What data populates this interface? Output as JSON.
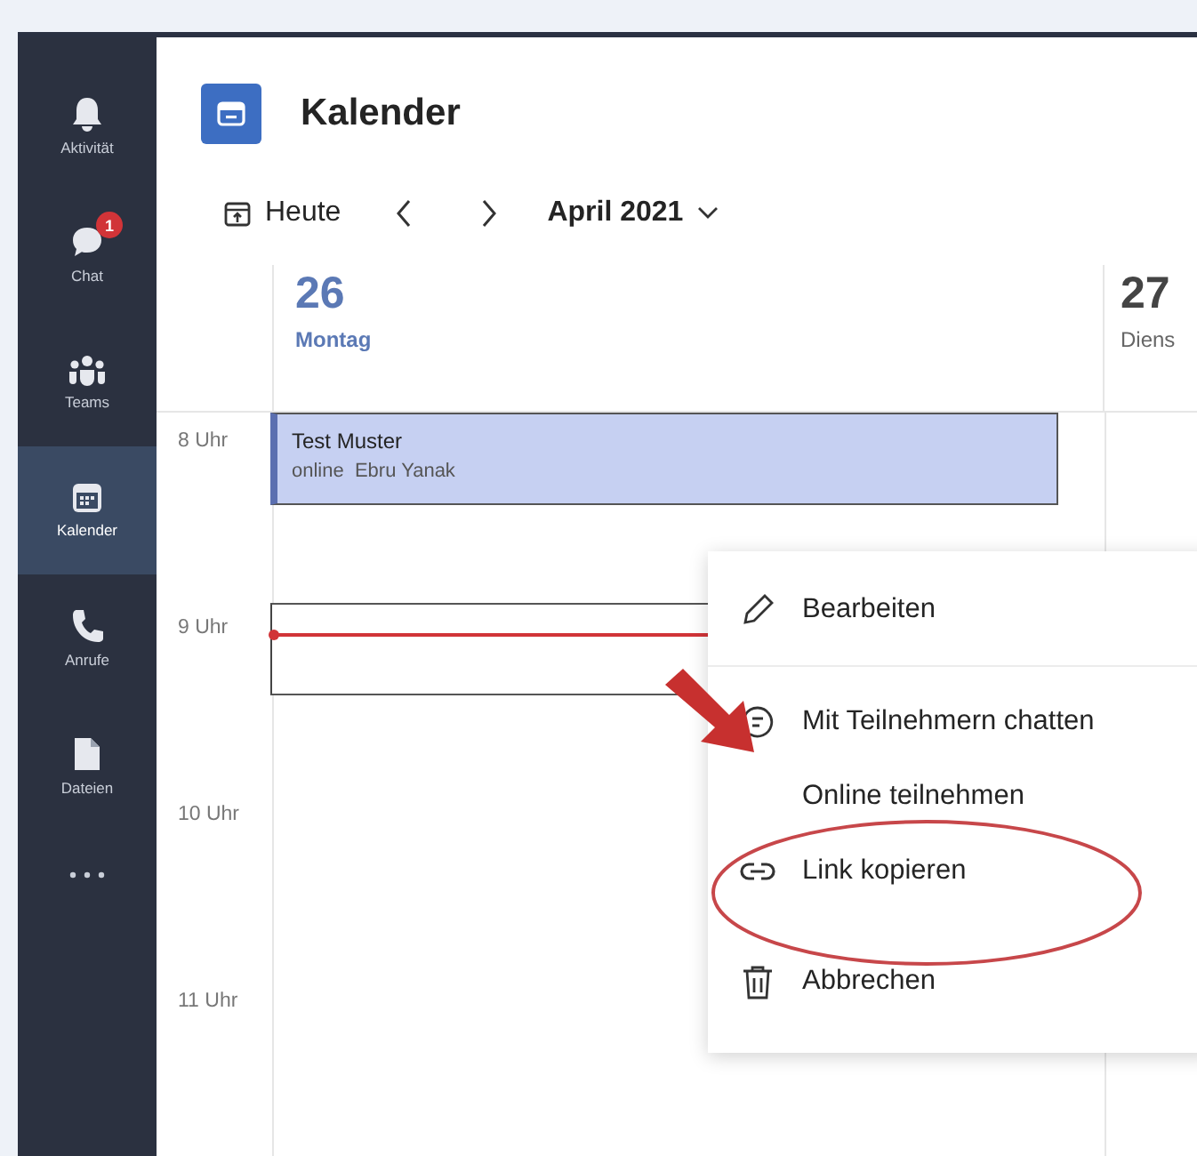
{
  "rail": {
    "items": [
      {
        "label": "Aktivität",
        "selected": false
      },
      {
        "label": "Chat",
        "badge": "1",
        "selected": false
      },
      {
        "label": "Teams",
        "selected": false
      },
      {
        "label": "Kalender",
        "selected": true
      },
      {
        "label": "Anrufe",
        "selected": false
      },
      {
        "label": "Dateien",
        "selected": false
      }
    ]
  },
  "header": {
    "title": "Kalender"
  },
  "toolbar": {
    "today": "Heute",
    "month": "April 2021"
  },
  "days": [
    {
      "number": "26",
      "name": "Montag",
      "selected": true
    },
    {
      "number": "27",
      "name": "Diens",
      "selected": false
    }
  ],
  "hours": [
    "8 Uhr",
    "9 Uhr",
    "10 Uhr",
    "11 Uhr"
  ],
  "events": [
    {
      "kind": "meeting",
      "title": "Test Muster",
      "details": "online  Ebru Yanak"
    },
    {
      "kind": "selection"
    }
  ],
  "context_menu": {
    "items": [
      {
        "label": "Bearbeiten"
      },
      {
        "label": "Mit Teilnehmern chatten"
      },
      {
        "label": "Online teilnehmen"
      },
      {
        "label": "Link kopieren"
      },
      {
        "label": "Abbrechen"
      }
    ]
  }
}
